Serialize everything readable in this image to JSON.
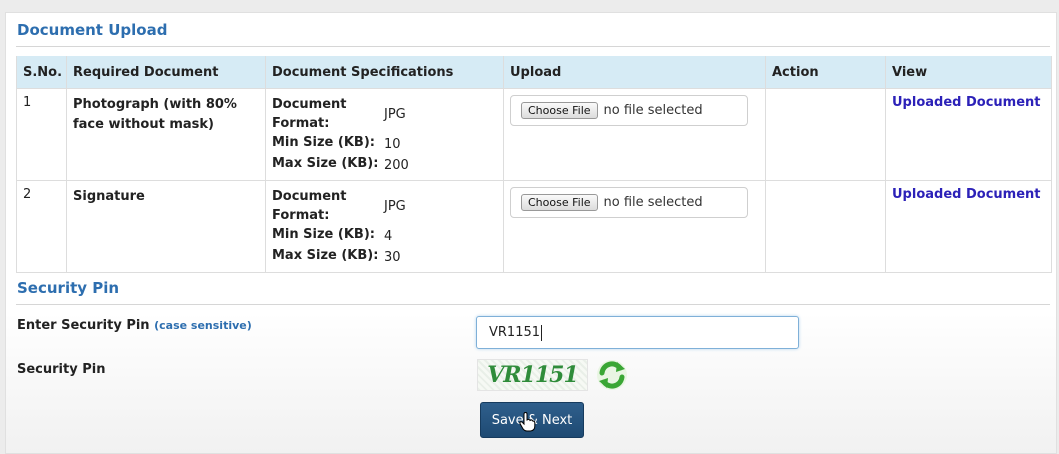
{
  "sections": {
    "upload_title": "Document Upload",
    "security_title": "Security Pin"
  },
  "table": {
    "headers": [
      "S.No.",
      "Required Document",
      "Document Specifications",
      "Upload",
      "Action",
      "View"
    ],
    "rows": [
      {
        "sno": "1",
        "document": "Photograph (with 80% face without mask)",
        "format_label": "Document Format:",
        "format": "JPG",
        "min_label": "Min Size (KB):",
        "min": "10",
        "max_label": "Max Size (KB):",
        "max": "200",
        "choose_label": "Choose File",
        "file_status": "no file selected",
        "action": "",
        "view_label": "Uploaded Document"
      },
      {
        "sno": "2",
        "document": "Signature",
        "format_label": "Document Format:",
        "format": "JPG",
        "min_label": "Min Size (KB):",
        "min": "4",
        "max_label": "Max Size (KB):",
        "max": "30",
        "choose_label": "Choose File",
        "file_status": "no file selected",
        "action": "",
        "view_label": "Uploaded Document"
      }
    ]
  },
  "security": {
    "enter_label": "Enter Security Pin",
    "enter_hint": "(case sensitive)",
    "pin_value": "VR1151",
    "pin_label": "Security Pin",
    "captcha_text": "VR1151",
    "refresh_icon": "refresh-icon"
  },
  "actions": {
    "save_next_label": "Save & Next"
  },
  "colors": {
    "section_title": "#2d6eaf",
    "table_header_bg": "#d6ebf5",
    "link": "#2c21b8",
    "button_bg": "#1e4a73",
    "captcha_text": "#2f8c3a"
  }
}
